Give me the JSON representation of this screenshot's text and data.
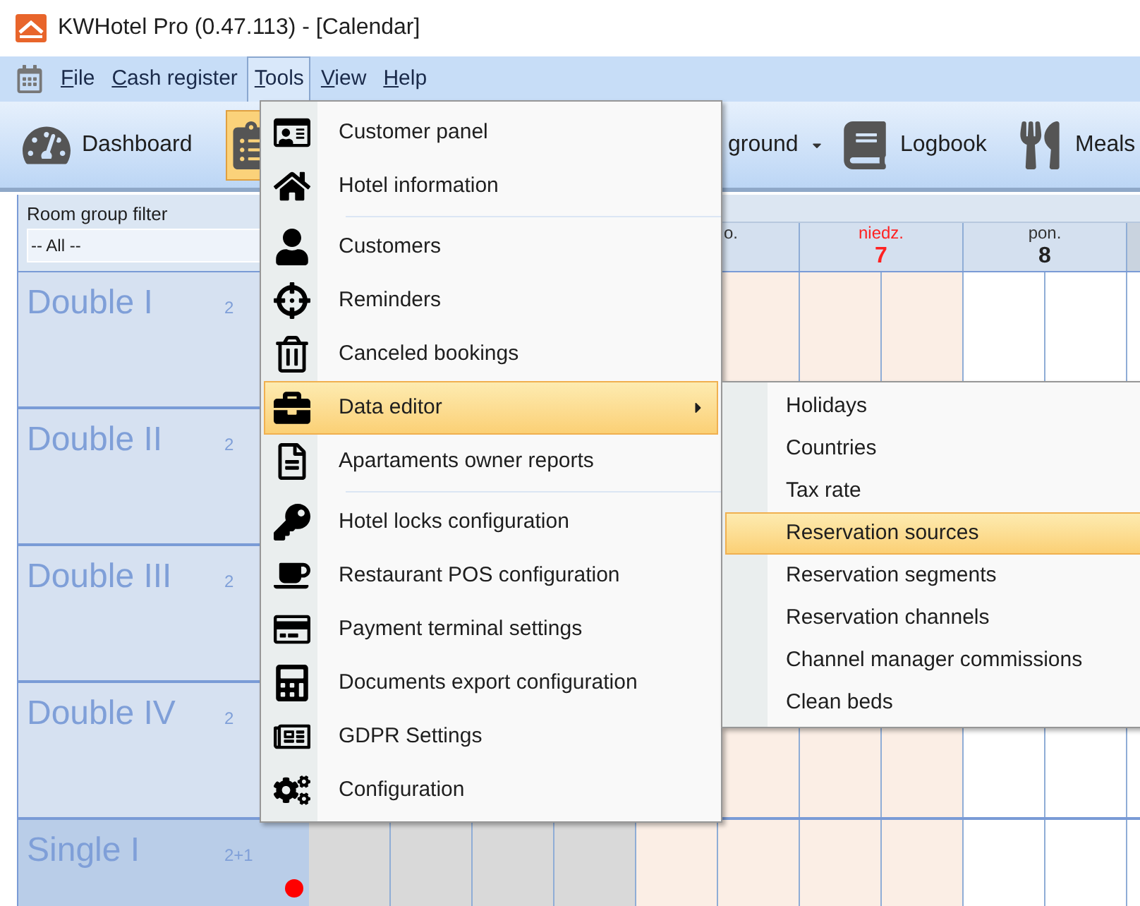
{
  "window": {
    "title": "KWHotel Pro (0.47.113) - [Calendar]"
  },
  "menu_bar": [
    {
      "label": "File",
      "selected": false
    },
    {
      "label": "Cash register",
      "selected": false
    },
    {
      "label": "Tools",
      "selected": true
    },
    {
      "label": "View",
      "selected": false
    },
    {
      "label": "Help",
      "selected": false
    }
  ],
  "toolbar": [
    {
      "label": "Dashboard",
      "selected": false,
      "dropdown": false
    },
    {
      "selected": true
    },
    {
      "label": "ground",
      "selected": false,
      "dropdown": true
    },
    {
      "label": "Logbook",
      "selected": false,
      "dropdown": false
    },
    {
      "label": "Meals",
      "selected": false,
      "dropdown": false
    }
  ],
  "room_filter": {
    "label": "Room group filter",
    "value": "-- All --"
  },
  "days": [
    {
      "weekend": false
    },
    {
      "weekend": false
    },
    {
      "weekday": "o.",
      "weekend": true,
      "holiday": false
    },
    {
      "weekday": "niedz.",
      "day": "7",
      "weekend": true,
      "holiday": true
    },
    {
      "weekday": "pon.",
      "day": "8",
      "weekend": false,
      "holiday": false
    }
  ],
  "rooms": [
    {
      "name": "Double I",
      "capacity": "2",
      "selected": false
    },
    {
      "name": "Double II",
      "capacity": "2",
      "selected": false
    },
    {
      "name": "Double III",
      "capacity": "2",
      "selected": false
    },
    {
      "name": "Double IV",
      "capacity": "2",
      "selected": false
    },
    {
      "name": "Single I",
      "capacity": "2+1",
      "selected": true,
      "alert": true
    }
  ],
  "tools_menu": [
    {
      "kind": "item",
      "label": "Customer panel",
      "selected": false
    },
    {
      "kind": "item",
      "label": "Hotel information",
      "selected": false
    },
    {
      "kind": "separator"
    },
    {
      "kind": "item",
      "label": "Customers",
      "selected": false
    },
    {
      "kind": "item",
      "label": "Reminders",
      "selected": false
    },
    {
      "kind": "item",
      "label": "Canceled bookings",
      "selected": false
    },
    {
      "kind": "submenu",
      "label": "Data editor",
      "selected": true
    },
    {
      "kind": "item",
      "label": "Apartaments owner reports",
      "selected": false
    },
    {
      "kind": "separator"
    },
    {
      "kind": "item",
      "label": "Hotel locks configuration",
      "selected": false
    },
    {
      "kind": "item",
      "label": "Restaurant POS configuration",
      "selected": false
    },
    {
      "kind": "item",
      "label": "Payment terminal settings",
      "selected": false
    },
    {
      "kind": "item",
      "label": "Documents export configuration",
      "selected": false
    },
    {
      "kind": "item",
      "label": "GDPR Settings",
      "selected": false
    },
    {
      "kind": "item",
      "label": "Configuration",
      "selected": false
    }
  ],
  "data_editor_menu": [
    {
      "label": "Holidays",
      "selected": false
    },
    {
      "label": "Countries",
      "selected": false
    },
    {
      "label": "Tax rate",
      "selected": false
    },
    {
      "label": "Reservation sources",
      "selected": true
    },
    {
      "label": "Reservation segments",
      "selected": false
    },
    {
      "label": "Reservation channels",
      "selected": false
    },
    {
      "label": "Channel manager commissions",
      "selected": false
    },
    {
      "label": "Clean beds",
      "selected": false
    }
  ]
}
